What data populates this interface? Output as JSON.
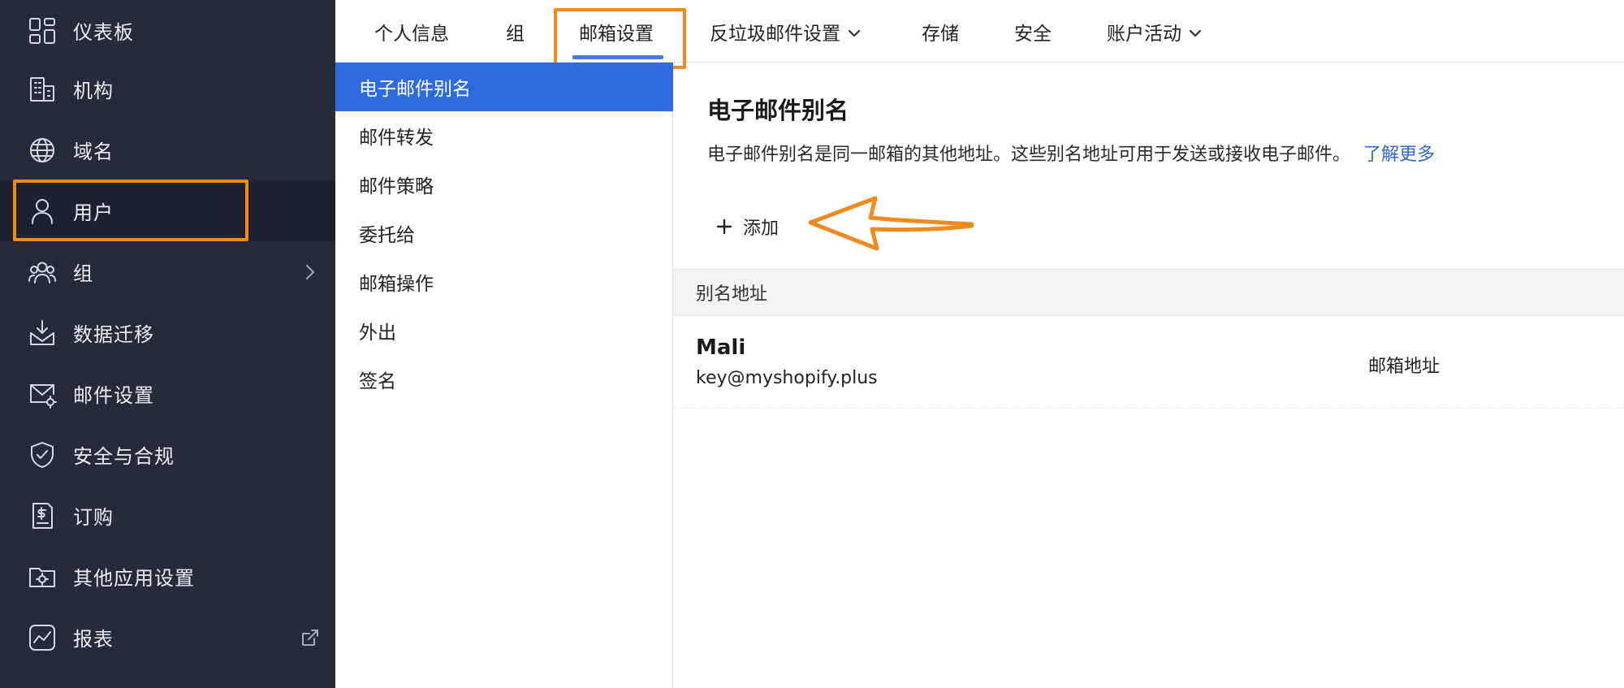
{
  "sidebar": {
    "items": [
      {
        "label": "仪表板",
        "icon": "dashboard-icon"
      },
      {
        "label": "机构",
        "icon": "building-icon"
      },
      {
        "label": "域名",
        "icon": "globe-icon"
      },
      {
        "label": "用户",
        "icon": "user-icon"
      },
      {
        "label": "组",
        "icon": "group-icon"
      },
      {
        "label": "数据迁移",
        "icon": "migration-icon"
      },
      {
        "label": "邮件设置",
        "icon": "mail-settings-icon"
      },
      {
        "label": "安全与合规",
        "icon": "shield-check-icon"
      },
      {
        "label": "订购",
        "icon": "billing-icon"
      },
      {
        "label": "其他应用设置",
        "icon": "app-settings-icon"
      },
      {
        "label": "报表",
        "icon": "reports-icon"
      }
    ]
  },
  "tabs": [
    {
      "label": "个人信息"
    },
    {
      "label": "组"
    },
    {
      "label": "邮箱设置"
    },
    {
      "label": "反垃圾邮件设置"
    },
    {
      "label": "存储"
    },
    {
      "label": "安全"
    },
    {
      "label": "账户活动"
    }
  ],
  "submenu": {
    "items": [
      "电子邮件别名",
      "邮件转发",
      "邮件策略",
      "委托给",
      "邮箱操作",
      "外出",
      "签名"
    ]
  },
  "content": {
    "title": "电子邮件别名",
    "description": "电子邮件别名是同一邮箱的其他地址。这些别名地址可用于发送或接收电子邮件。",
    "learn_more": "了解更多",
    "add_label": "添加",
    "table": {
      "header": "别名地址",
      "rows": [
        {
          "name": "Mali",
          "email": "key@myshopify.plus",
          "type": "邮箱地址"
        }
      ]
    }
  },
  "colors": {
    "sidebar_bg": "#262a39",
    "accent": "#2e6be0",
    "highlight": "#f08a1c",
    "link": "#2f66c9"
  }
}
